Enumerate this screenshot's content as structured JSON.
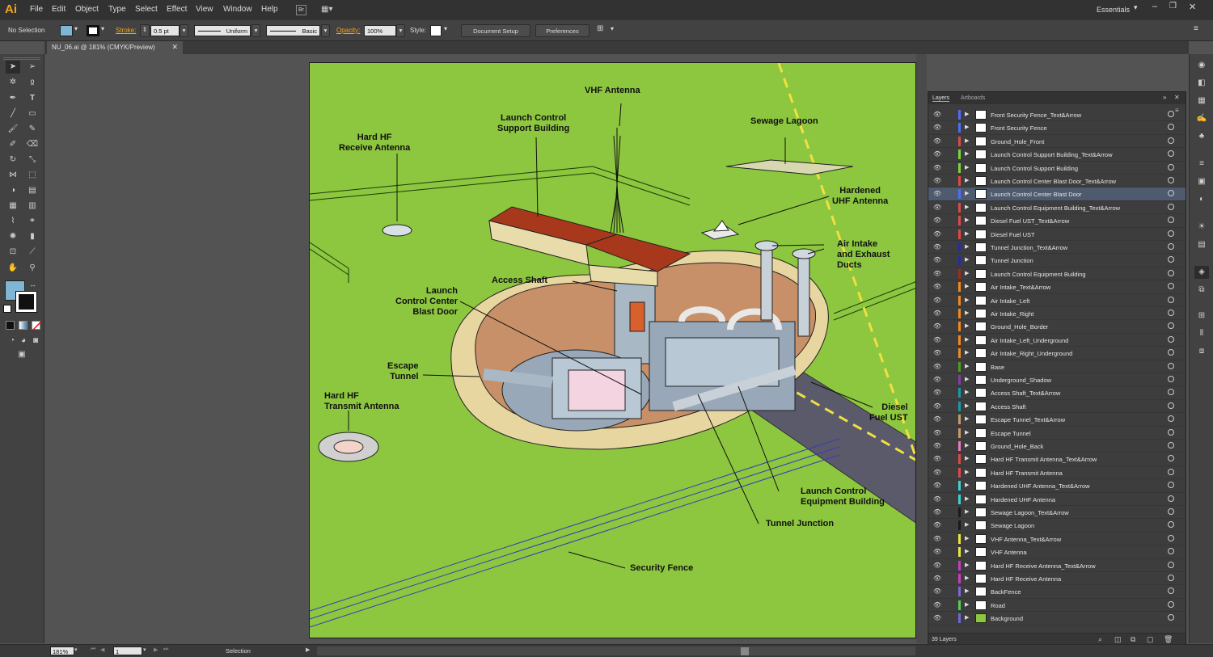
{
  "app": {
    "logo": "Ai",
    "workspace": "Essentials"
  },
  "menu": [
    "File",
    "Edit",
    "Object",
    "Type",
    "Select",
    "Effect",
    "View",
    "Window",
    "Help"
  ],
  "menu_extra": {
    "bridge": "Br"
  },
  "control_bar": {
    "selection": "No Selection",
    "stroke_label": "Stroke:",
    "stroke_value": "0.5 pt",
    "profile": "Uniform",
    "brush": "Basic",
    "opacity_label": "Opacity:",
    "opacity_value": "100%",
    "style_label": "Style:",
    "doc_setup": "Document Setup",
    "preferences": "Preferences"
  },
  "document": {
    "tab_title": "NU_06.ai @ 181% (CMYK/Preview)"
  },
  "colors": {
    "artboard_bg": "#8dc63f",
    "selected_layer": "#4e5a6e",
    "logo": "#f7a21b"
  },
  "illustration_labels": {
    "vhf": "VHF Antenna",
    "lcsb": "Launch Control\nSupport Building",
    "sewage": "Sewage Lagoon",
    "hard_hf_rx": "Hard HF\nReceive Antenna",
    "uhf": "Hardened\nUHF Antenna",
    "air_intake": "Air Intake\nand Exhaust\nDucts",
    "access_shaft": "Access Shaft",
    "blast_door": "Launch\nControl Center\nBlast Door",
    "escape": "Escape\nTunnel",
    "hard_hf_tx": "Hard HF\nTransmit Antenna",
    "diesel": "Diesel\nFuel UST",
    "lceb": "Launch Control\nEquipment Building",
    "tunnel_junction": "Tunnel Junction",
    "fence": "Security Fence"
  },
  "layers_panel": {
    "tabs": [
      "Layers",
      "Artboards"
    ],
    "count_label": "39 Layers",
    "selected_index": 6,
    "layers": [
      {
        "name": "Front Security Fence_Text&Arrow",
        "color": "#4f6cff"
      },
      {
        "name": "Front Security Fence",
        "color": "#4f6cff"
      },
      {
        "name": "Ground_Hole_Front",
        "color": "#e04848"
      },
      {
        "name": "Launch Control Support Building_Text&Arrow",
        "color": "#7fd23a"
      },
      {
        "name": "Launch Control Support Building",
        "color": "#7fd23a"
      },
      {
        "name": "Launch Control Center Blast Door_Text&Arrow",
        "color": "#e04848"
      },
      {
        "name": "Launch Control Center Blast Door",
        "color": "#4f6cff"
      },
      {
        "name": "Launch Control Equipment Building_Text&Arrow",
        "color": "#e04848"
      },
      {
        "name": "Diesel Fuel UST_Text&Arrow",
        "color": "#e04848"
      },
      {
        "name": "Diesel Fuel UST",
        "color": "#e04848"
      },
      {
        "name": "Tunnel Junction_Text&Arrow",
        "color": "#2a2aa8"
      },
      {
        "name": "Tunnel Junction",
        "color": "#2a2aa8"
      },
      {
        "name": "Launch Control Equipment Building",
        "color": "#a8281c"
      },
      {
        "name": "Air Intake_Text&Arrow",
        "color": "#f08a1c"
      },
      {
        "name": "Air Intake_Left",
        "color": "#f08a1c"
      },
      {
        "name": "Air Intake_Right",
        "color": "#f08a1c"
      },
      {
        "name": "Ground_Hole_Border",
        "color": "#f08a1c"
      },
      {
        "name": "Air Intake_Left_Underground",
        "color": "#f08a1c"
      },
      {
        "name": "Air Intake_Right_Underground",
        "color": "#f08a1c"
      },
      {
        "name": "Base",
        "color": "#4f9a2a"
      },
      {
        "name": "Underground_Shadow",
        "color": "#8a3aa8"
      },
      {
        "name": "Access Shaft_Text&Arrow",
        "color": "#1a9aa8"
      },
      {
        "name": "Access Shaft",
        "color": "#1a9aa8"
      },
      {
        "name": "Escape Tunnel_Text&Arrow",
        "color": "#c89a6a"
      },
      {
        "name": "Escape Tunnel",
        "color": "#c89a6a"
      },
      {
        "name": "Ground_Hole_Back",
        "color": "#e87ab8"
      },
      {
        "name": "Hard HF Transmit Antenna_Text&Arrow",
        "color": "#e04848"
      },
      {
        "name": "Hard HF Transmit Antenna",
        "color": "#e04848"
      },
      {
        "name": "Hardened UHF Antenna_Text&Arrow",
        "color": "#3ad2d2"
      },
      {
        "name": "Hardened UHF Antenna",
        "color": "#3ad2d2"
      },
      {
        "name": "Sewage Lagoon_Text&Arrow",
        "color": "#1a1a1a"
      },
      {
        "name": "Sewage Lagoon",
        "color": "#1a1a1a"
      },
      {
        "name": "VHF Antenna_Text&Arrow",
        "color": "#e8e83a"
      },
      {
        "name": "VHF Antenna",
        "color": "#e8e83a"
      },
      {
        "name": "Hard HF Receive Antenna_Text&Arrow",
        "color": "#c83ac8"
      },
      {
        "name": "Hard HF Receive Antenna",
        "color": "#c83ac8"
      },
      {
        "name": "BackFence",
        "color": "#7a6ad2"
      },
      {
        "name": "Road",
        "color": "#4fd24f"
      },
      {
        "name": "Background",
        "color": "#6a6ad2"
      }
    ]
  },
  "status_bar": {
    "zoom": "181%",
    "page": "1",
    "tool": "Selection"
  }
}
